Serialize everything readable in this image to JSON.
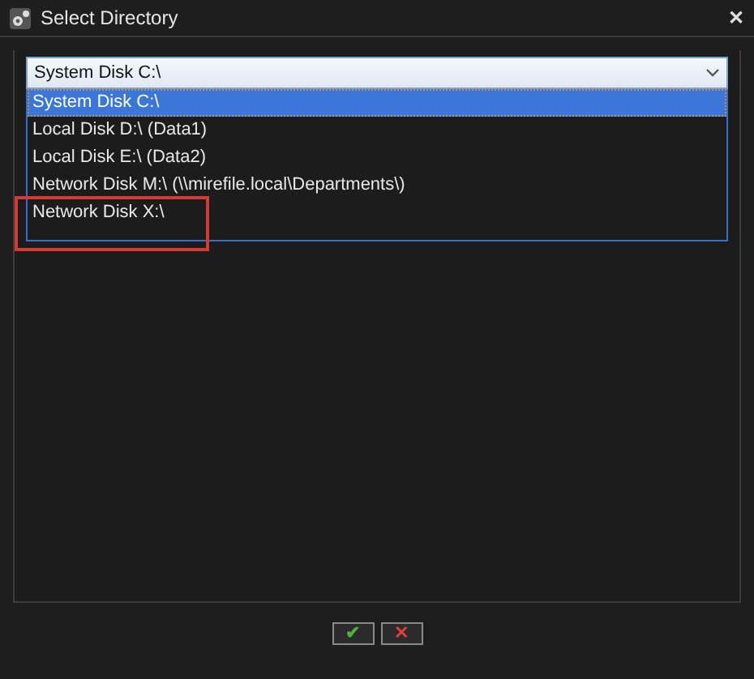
{
  "window": {
    "title": "Select Directory",
    "close": "✕"
  },
  "dropdown": {
    "value": "System Disk C:\\"
  },
  "options": [
    {
      "label": "System Disk C:\\",
      "selected": true,
      "highlighted": false
    },
    {
      "label": "Local Disk D:\\ (Data1)",
      "selected": false,
      "highlighted": false
    },
    {
      "label": "Local Disk E:\\ (Data2)",
      "selected": false,
      "highlighted": false
    },
    {
      "label": "Network Disk M:\\ (\\\\mirefile.local\\Departments\\)",
      "selected": false,
      "highlighted": false
    },
    {
      "label": "Network Disk X:\\",
      "selected": false,
      "highlighted": true
    }
  ],
  "buttons": [
    {
      "kind": "ok",
      "label": "✔"
    },
    {
      "kind": "cancel",
      "label": "✕"
    }
  ]
}
